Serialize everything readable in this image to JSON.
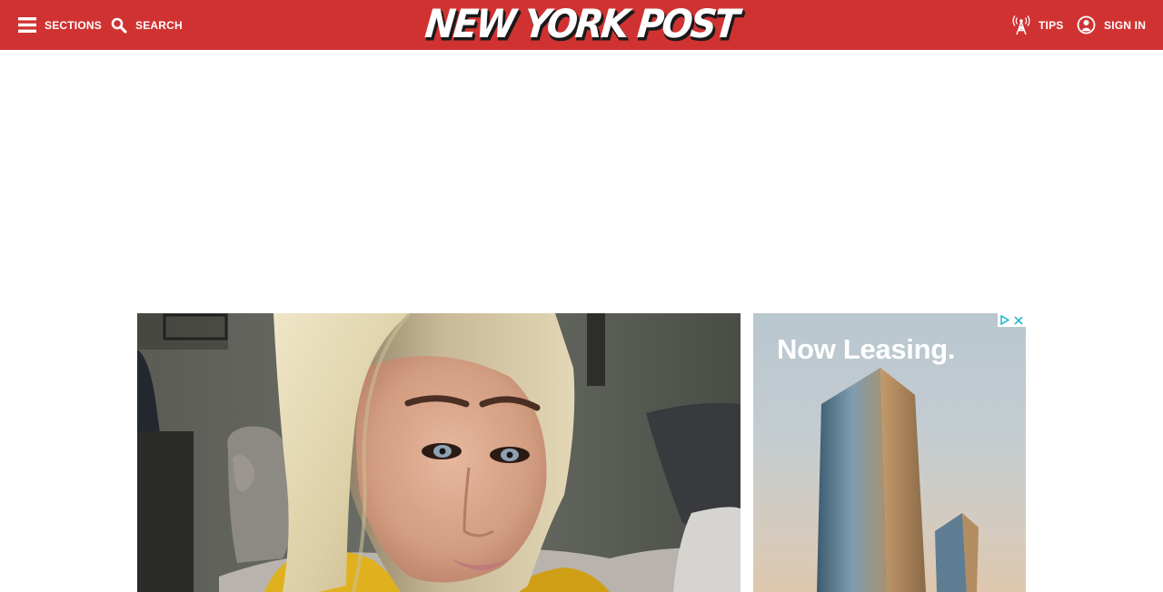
{
  "header": {
    "sections_label": "SECTIONS",
    "search_label": "SEARCH",
    "logo_text": "NEW YORK POST",
    "tips_label": "TIPS",
    "signin_label": "SIGN IN",
    "icons": {
      "menu": "hamburger-menu-icon",
      "search": "magnifier-search-icon",
      "tips": "radio-tower-icon",
      "signin": "user-circle-icon"
    },
    "colors": {
      "bar": "#d03232",
      "text": "#ffffff"
    }
  },
  "sidebar_ad": {
    "headline": "Now Leasing.",
    "icons": {
      "adchoices": "adchoices-icon",
      "close": "close-icon"
    }
  }
}
